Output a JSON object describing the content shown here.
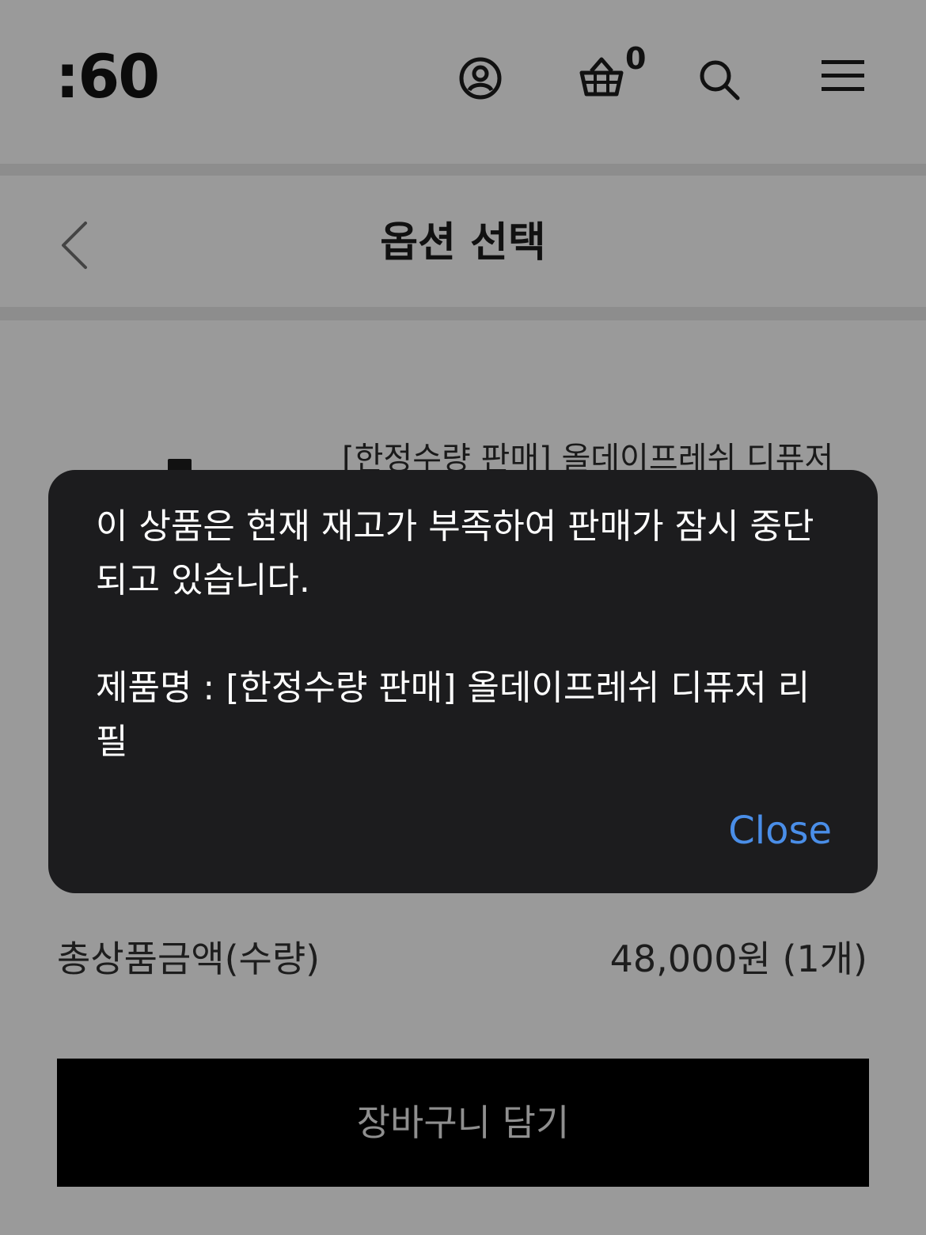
{
  "header": {
    "logo": ":60",
    "cart_count": "0",
    "icons": [
      "account-icon",
      "cart-icon",
      "search-icon",
      "menu-icon"
    ]
  },
  "titlebar": {
    "title": "옵션 선택",
    "back_icon": "chevron-left-icon"
  },
  "product": {
    "name": "[한정수량 판매] 올데이프레쉬 디퓨저"
  },
  "summary": {
    "label": "총상품금액(수량)",
    "value": "48,000원 (1개)"
  },
  "actions": {
    "add_to_cart": "장바구니 담기"
  },
  "modal": {
    "message": "이 상품은 현재 재고가 부족하여 판매가 잠시 중단되고 있습니다.\n\n제품명 : [한정수량 판매] 올데이프레쉬 디퓨저 리필",
    "close_label": "Close"
  },
  "colors": {
    "background": "#9a9a9a",
    "modal_bg": "#1c1c1e",
    "close_link": "#4a8ee8",
    "button_bg": "#000000"
  }
}
